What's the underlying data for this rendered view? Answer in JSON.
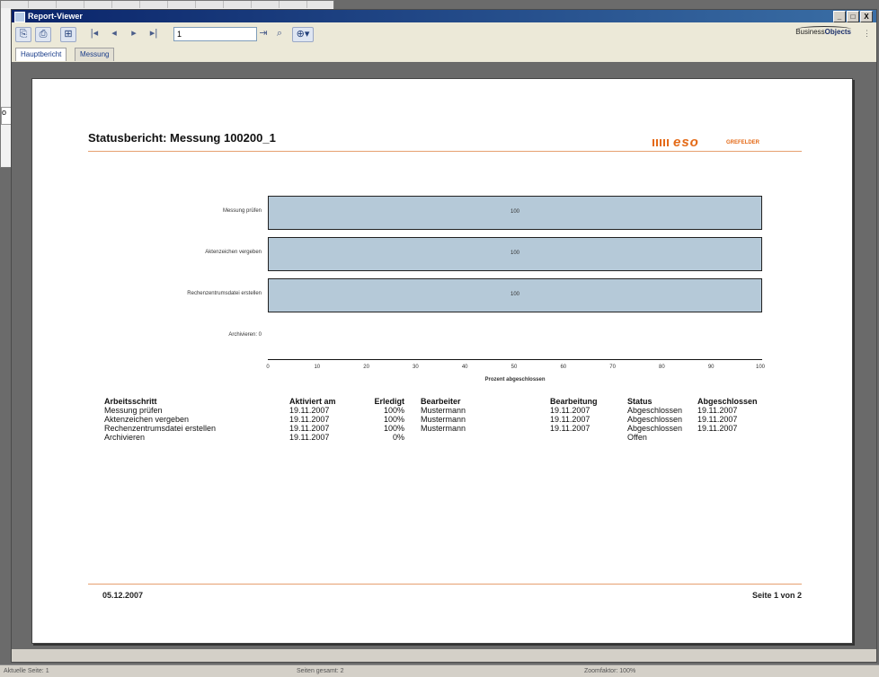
{
  "window": {
    "title": "Report-Viewer",
    "minimize": "_",
    "maximize": "□",
    "close": "X"
  },
  "toolbar": {
    "page_input_value": "1",
    "brand": "BusinessObjects",
    "brand_prefix": "Business",
    "brand_suffix": "Objects"
  },
  "tabs": [
    {
      "label": "Hauptbericht"
    },
    {
      "label": "Messung"
    }
  ],
  "report": {
    "title": "Statusbericht: Messung 100200_1",
    "logo_text": "eso",
    "logo_sub": "GREFELDER"
  },
  "chart_data": {
    "type": "bar",
    "orientation": "horizontal",
    "categories": [
      "Messung prüfen",
      "Aktenzeichen vergeben",
      "Rechenzentrumsdatei erstellen",
      "Archivieren"
    ],
    "values": [
      100,
      100,
      100,
      0
    ],
    "value_labels": [
      "100",
      "100",
      "100",
      ""
    ],
    "category_labels": [
      "Messung prüfen",
      "Aktenzeichen vergeben",
      "Rechenzentrumsdatei erstellen",
      "Archivieren: 0"
    ],
    "xlabel": "Prozent abgeschlossen",
    "xlim": [
      0,
      100
    ],
    "xticks": [
      0,
      10,
      20,
      30,
      40,
      50,
      60,
      70,
      80,
      90,
      100
    ],
    "bar_color": "#b5c9d8"
  },
  "table": {
    "headers": [
      "Arbeitsschritt",
      "Aktiviert am",
      "Erledigt",
      "Bearbeiter",
      "Bearbeitung",
      "Status",
      "Abgeschlossen"
    ],
    "rows": [
      [
        "Messung prüfen",
        "19.11.2007",
        "100%",
        "Mustermann",
        "19.11.2007",
        "Abgeschlossen",
        "19.11.2007"
      ],
      [
        "Aktenzeichen vergeben",
        "19.11.2007",
        "100%",
        "Mustermann",
        "19.11.2007",
        "Abgeschlossen",
        "19.11.2007"
      ],
      [
        "Rechenzentrumsdatei erstellen",
        "19.11.2007",
        "100%",
        "Mustermann",
        "19.11.2007",
        "Abgeschlossen",
        "19.11.2007"
      ],
      [
        "Archivieren",
        "19.11.2007",
        "0%",
        "",
        "",
        "Offen",
        ""
      ]
    ]
  },
  "footer": {
    "date": "05.12.2007",
    "page": "Seite 1 von 2"
  },
  "statusbar": {
    "current_page": "Aktuelle Seite: 1",
    "pages_exported": "Seiten gesamt: 2",
    "zoom": "Zoomfaktor: 100%"
  },
  "colors": {
    "accent": "#e46a17",
    "title_bar": "#0a246a"
  }
}
